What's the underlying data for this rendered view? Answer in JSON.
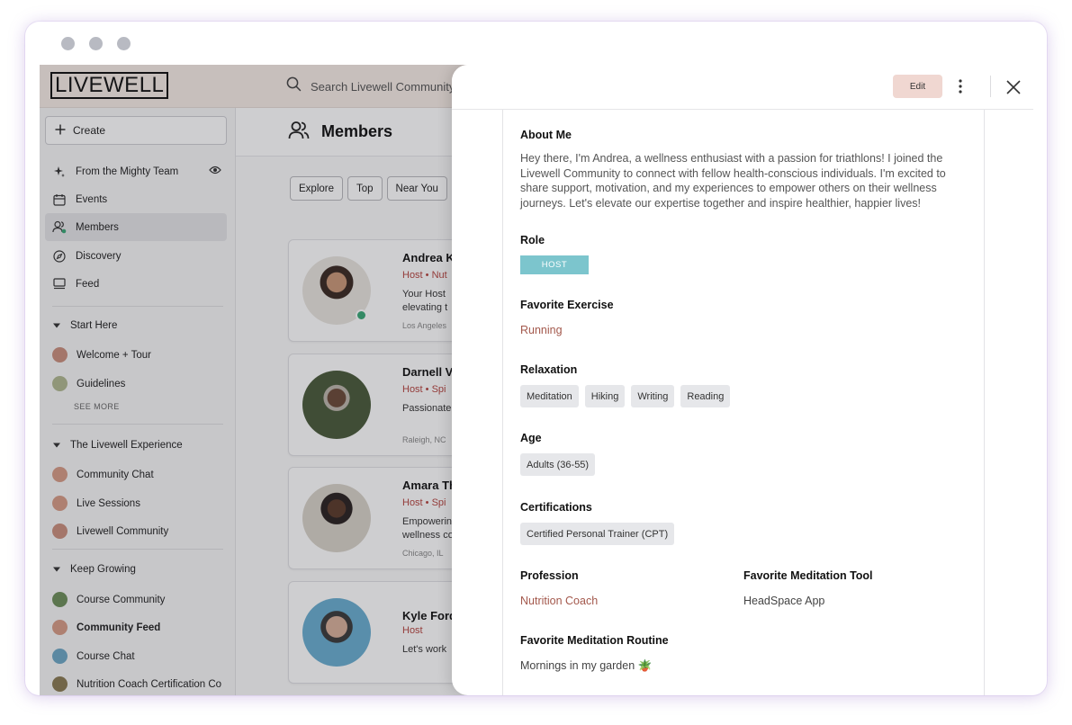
{
  "app": {
    "logo_text": "LIVEWELL",
    "search_placeholder": "Search Livewell Community"
  },
  "sidebar": {
    "create_label": "Create",
    "nav": [
      {
        "label": "From the Mighty Team",
        "icon": "sparkle-icon"
      },
      {
        "label": "Events",
        "icon": "calendar-icon"
      },
      {
        "label": "Members",
        "icon": "people-icon"
      },
      {
        "label": "Discovery",
        "icon": "compass-icon"
      },
      {
        "label": "Feed",
        "icon": "feed-icon"
      }
    ],
    "sections": [
      {
        "title": "Start Here",
        "items": [
          {
            "label": "Welcome + Tour",
            "color": "#c98f7d"
          },
          {
            "label": "Guidelines",
            "color": "#b0b890"
          }
        ],
        "see_more": "SEE MORE"
      },
      {
        "title": "The Livewell Experience",
        "items": [
          {
            "label": "Community Chat",
            "color": "#d69b86"
          },
          {
            "label": "Live Sessions",
            "color": "#d69b86"
          },
          {
            "label": "Livewell Community",
            "color": "#c98f7d"
          }
        ]
      },
      {
        "title": "Keep Growing",
        "items": [
          {
            "label": "Course Community",
            "color": "#6e8f5a"
          },
          {
            "label": "Community Feed",
            "color": "#d69b86"
          },
          {
            "label": "Course Chat",
            "color": "#6ea7c4"
          },
          {
            "label": "Nutrition Coach Certification Co",
            "color": "#8a7a52"
          }
        ]
      }
    ]
  },
  "members": {
    "title": "Members",
    "filters": [
      "Explore",
      "Top",
      "Near You"
    ],
    "cards": [
      {
        "name": "Andrea K",
        "role": "Host • Nut",
        "desc1": "Your Host",
        "desc2": "elevating t",
        "location": "Los Angeles"
      },
      {
        "name": "Darnell V",
        "role": "Host • Spi",
        "desc1": "Passionate",
        "desc2": "",
        "location": "Raleigh, NC"
      },
      {
        "name": "Amara Th",
        "role": "Host • Spi",
        "desc1": "Empowerin",
        "desc2": "wellness co",
        "location": "Chicago, IL"
      },
      {
        "name": "Kyle Ford",
        "role": "Host",
        "desc1": "Let's work",
        "desc2": "",
        "location": ""
      }
    ]
  },
  "profile": {
    "edit_label": "Edit",
    "about_label": "About Me",
    "about_text": "Hey there, I'm Andrea, a wellness enthusiast with a passion for triathlons! I joined the Livewell Community to connect with fellow health-conscious individuals. I'm excited to share support, motivation, and my experiences to empower others on their wellness journeys. Let's elevate our expertise together and inspire healthier, happier lives!",
    "role_label": "Role",
    "role_value": "HOST",
    "exercise_label": "Favorite Exercise",
    "exercise_value": "Running",
    "relaxation_label": "Relaxation",
    "relaxation_tags": [
      "Meditation",
      "Hiking",
      "Writing",
      "Reading"
    ],
    "age_label": "Age",
    "age_value": "Adults (36-55)",
    "cert_label": "Certifications",
    "cert_value": "Certified Personal Trainer (CPT)",
    "profession_label": "Profession",
    "profession_value": "Nutrition Coach",
    "tool_label": "Favorite Meditation Tool",
    "tool_value": "HeadSpace App",
    "routine_label": "Favorite Meditation Routine",
    "routine_value": "Mornings in my garden 🪴"
  },
  "colors": {
    "accent_link": "#a3584c",
    "host_badge": "#7cc5cd",
    "edit_button": "#f0d7d1",
    "online": "#3aa876"
  }
}
